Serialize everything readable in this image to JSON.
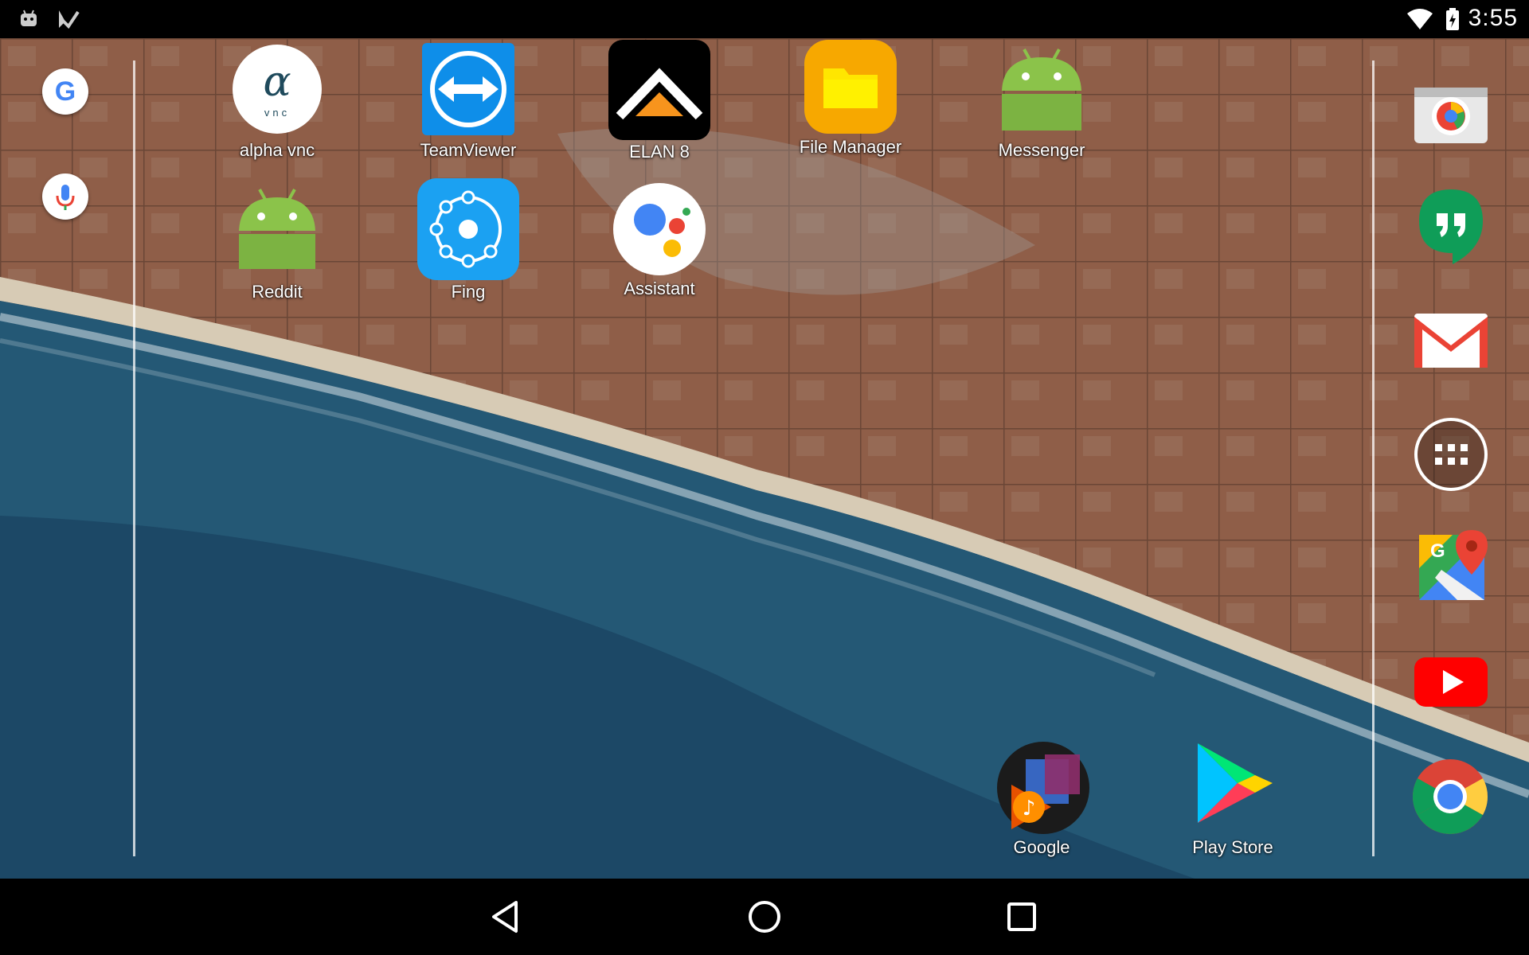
{
  "status_bar": {
    "time": "3:55",
    "icons": [
      "android-debug-icon",
      "task-check-icon",
      "wifi-icon",
      "battery-charging-icon"
    ]
  },
  "left_rail": {
    "items": [
      {
        "name": "google-search-icon"
      },
      {
        "name": "voice-search-icon"
      }
    ]
  },
  "home_grid": {
    "apps": [
      {
        "label": "alpha vnc",
        "icon": "alpha-vnc-icon"
      },
      {
        "label": "TeamViewer",
        "icon": "teamviewer-icon"
      },
      {
        "label": "ELAN 8",
        "icon": "elan-icon"
      },
      {
        "label": "File Manager",
        "icon": "folder-icon"
      },
      {
        "label": "Messenger",
        "icon": "android-robot-icon"
      },
      {
        "label": "Reddit",
        "icon": "android-robot-icon"
      },
      {
        "label": "Fing",
        "icon": "fing-icon"
      },
      {
        "label": "Assistant",
        "icon": "assistant-icon"
      },
      {
        "label": "Google",
        "icon": "play-music-icon"
      },
      {
        "label": "Play Store",
        "icon": "play-store-icon"
      }
    ]
  },
  "dock": {
    "items": [
      "camera-icon",
      "hangouts-icon",
      "gmail-icon",
      "app-drawer-icon",
      "maps-icon",
      "youtube-icon",
      "chrome-icon"
    ]
  },
  "nav_bar": {
    "buttons": [
      "back-icon",
      "home-icon",
      "recents-icon"
    ]
  },
  "colors": {
    "teamviewer": "#0E8EE9",
    "file_manager": "#F7A800",
    "android_green": "#8BC34A",
    "fing": "#1BA1F2",
    "youtube": "#FF0000",
    "hangouts": "#0F9D58"
  }
}
